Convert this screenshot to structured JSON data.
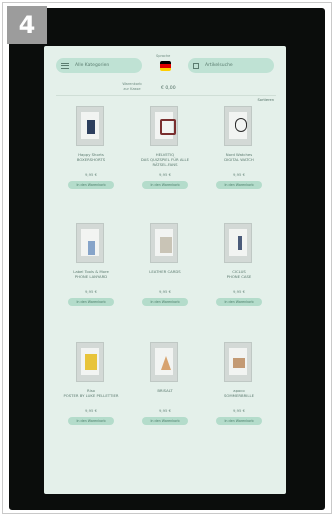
{
  "step_number": "4",
  "header": {
    "left_pill": "Alle Kategorien",
    "right_pill": "Artikelsuche",
    "language_label": "Sprache",
    "flag_colors": [
      "#000000",
      "#dd0000",
      "#ffce00"
    ],
    "cart_label": "Warenkorb\nzur Kasse",
    "cart_total": "€ 0,00",
    "sort_label": "Sortieren"
  },
  "products": [
    {
      "name": "Happy Shorts\nBOXERSHORTS",
      "price": "9,95 €",
      "button": "In den Warenkorb"
    },
    {
      "name": "HELVETIQ\nDAS QUIZSPIEL FÜR ALLE\nRÄTSEL-FANS",
      "price": "9,95 €",
      "button": "In den Warenkorb"
    },
    {
      "name": "Nord Watches\nDIGITAL WATCH",
      "price": "9,95 €",
      "button": "In den Warenkorb"
    },
    {
      "name": "Label Tools & More\nPHONE LANYARD",
      "price": "9,95 €",
      "button": "In den Warenkorb"
    },
    {
      "name": "LEATHER CARDS",
      "price": "9,95 €",
      "button": "In den Warenkorb"
    },
    {
      "name": "CICLUS\nPHONE CASE",
      "price": "9,95 €",
      "button": "In den Warenkorb"
    },
    {
      "name": "Riso\nPOSTER BY LUKE PELLETTIER",
      "price": "9,95 €",
      "button": "In den Warenkorb"
    },
    {
      "name": "BRISALT",
      "price": "9,95 €",
      "button": "In den Warenkorb"
    },
    {
      "name": "apoco\nSOMMERBRILLE",
      "price": "9,95 €",
      "button": "In den Warenkorb"
    }
  ]
}
